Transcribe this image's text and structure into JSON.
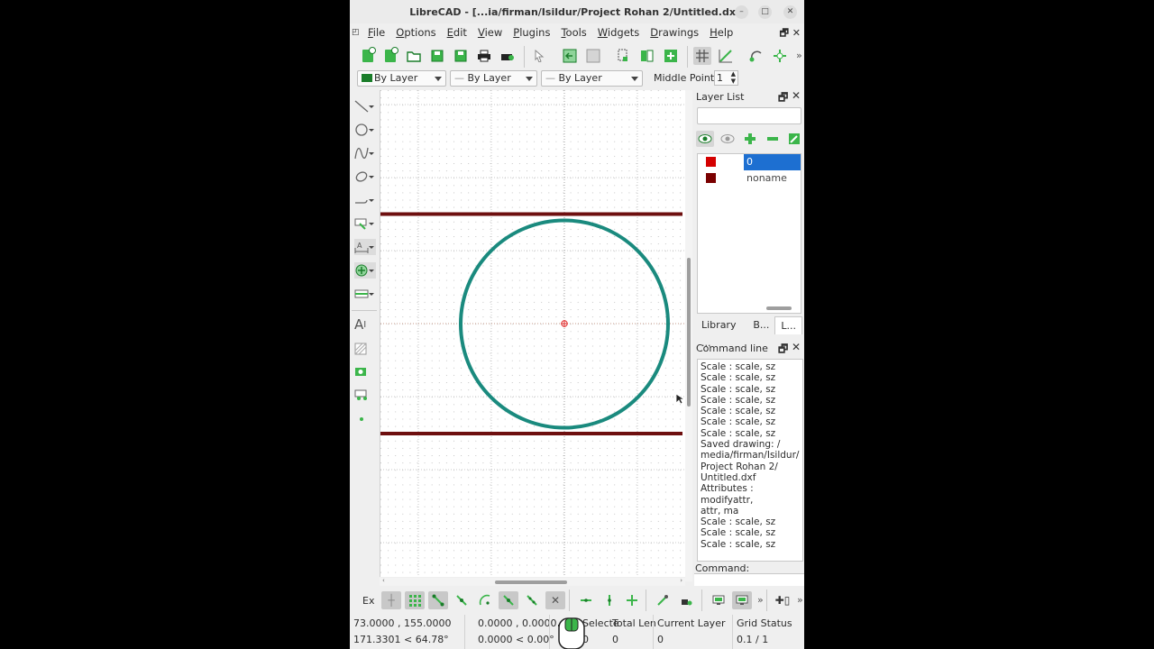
{
  "window": {
    "title": "LibreCAD - [...ia/firman/Isildur/Project Rohan 2/Untitled.dxf]"
  },
  "menu": [
    "File",
    "Options",
    "Edit",
    "View",
    "Plugins",
    "Tools",
    "Widgets",
    "Drawings",
    "Help"
  ],
  "pen": {
    "color": "By Layer",
    "linetype": "By Layer",
    "width": "By Layer"
  },
  "snap_middle": {
    "label": "Middle Points",
    "value": "1"
  },
  "layer_panel": {
    "title": "Layer List",
    "search_placeholder": "",
    "layers": [
      {
        "name": "0",
        "color": "#d40000",
        "selected": true
      },
      {
        "name": "noname",
        "color": "#7a0000",
        "selected": false
      }
    ],
    "tabs": [
      "Library ...",
      "B...",
      "L..."
    ]
  },
  "command_panel": {
    "title": "Command line",
    "lines": [
      "Scale : scale, sz",
      "Scale : scale, sz",
      "Scale : scale, sz",
      "Scale : scale, sz",
      "Scale : scale, sz",
      "Scale : scale, sz",
      "Scale : scale, sz",
      "Saved drawing: /",
      "media/firman/Isildur/",
      "Project Rohan 2/",
      "Untitled.dxf",
      "Attributes : modifyattr,",
      "attr, ma",
      "Scale : scale, sz",
      "Scale : scale, sz",
      "Scale : scale, sz"
    ],
    "prompt": "Command:"
  },
  "snap_toolbar": {
    "label": "Ex"
  },
  "status": {
    "abs_coord": "73.0000 , 155.0000",
    "abs_polar": "171.3301 < 64.78°",
    "rel_coord": "0.0000 , 0.0000",
    "rel_polar": "0.0000 < 0.00°",
    "selected_label": "Selecte",
    "selected_value": "0",
    "total_len_label": "Total Len",
    "total_len_value": "0",
    "current_layer_label": "Current Layer",
    "current_layer_value": "0",
    "grid_label": "Grid Status",
    "grid_value": "0.1 / 1"
  },
  "colors": {
    "circle": "#1a8a7e",
    "lines": "#6e0f0f",
    "accent_select": "#1d6fd1",
    "icon_green": "#3bb54a"
  }
}
